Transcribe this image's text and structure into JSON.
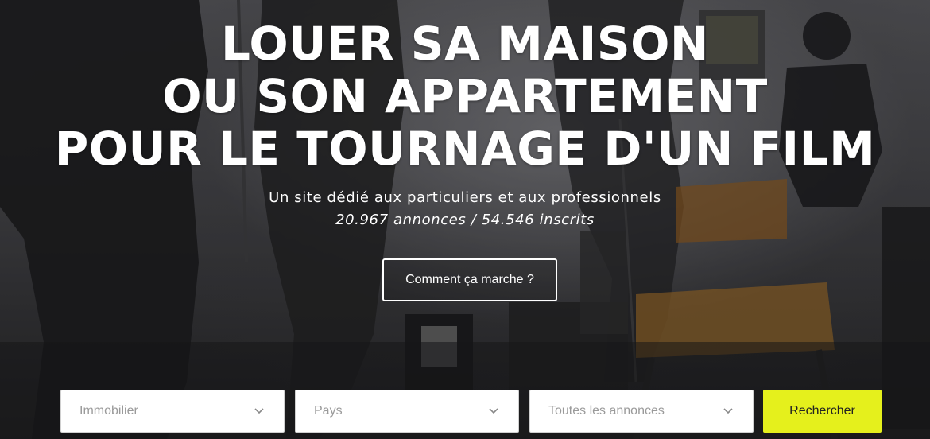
{
  "hero": {
    "title_lines": [
      "LOUER SA MAISON",
      "OU SON APPARTEMENT",
      "POUR LE TOURNAGE D'UN FILM"
    ],
    "subtitle": "Un site dédié aux particuliers et aux professionnels",
    "stats": "20.967 annonces / 54.546 inscrits",
    "how_button": "Comment ça marche ?"
  },
  "search": {
    "category": {
      "value": "Immobilier",
      "icon": "chevron-down-icon"
    },
    "country": {
      "value": "Pays",
      "icon": "chevron-down-icon"
    },
    "listings": {
      "value": "Toutes les annonces",
      "icon": "chevron-down-icon"
    },
    "submit_label": "Rechercher"
  },
  "colors": {
    "accent": "#e5f01c",
    "text_on_hero": "#ffffff",
    "select_text": "#9a9a9a"
  }
}
